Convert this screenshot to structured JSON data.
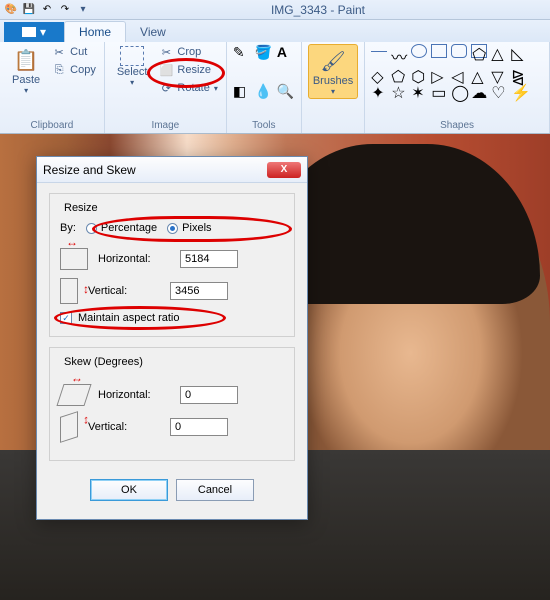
{
  "window": {
    "title": "IMG_3343 - Paint"
  },
  "tabs": {
    "file": "",
    "home": "Home",
    "view": "View"
  },
  "groups": {
    "clipboard": "Clipboard",
    "image": "Image",
    "tools": "Tools",
    "shapes": "Shapes"
  },
  "clipboard": {
    "paste": "Paste",
    "cut": "Cut",
    "copy": "Copy"
  },
  "image_grp": {
    "select": "Select",
    "crop": "Crop",
    "resize": "Resize",
    "rotate": "Rotate"
  },
  "brushes": {
    "label": "Brushes"
  },
  "dialog": {
    "title": "Resize and Skew",
    "resize_legend": "Resize",
    "by_label": "By:",
    "percentage": "Percentage",
    "pixels": "Pixels",
    "horizontal": "Horizontal:",
    "vertical": "Vertical:",
    "h_val": "5184",
    "v_val": "3456",
    "aspect": "Maintain aspect ratio",
    "skew_legend": "Skew (Degrees)",
    "skew_h": "0",
    "skew_v": "0",
    "ok": "OK",
    "cancel": "Cancel"
  }
}
